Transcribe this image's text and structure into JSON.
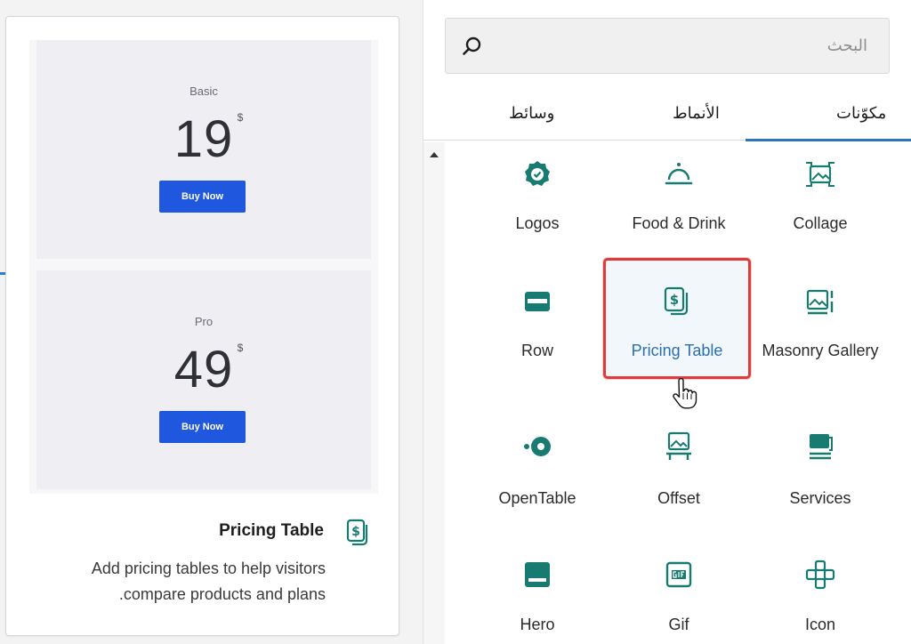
{
  "preview": {
    "plans": [
      {
        "name": "Basic",
        "price": "19",
        "currency": "$",
        "button": "Buy Now"
      },
      {
        "name": "Pro",
        "price": "49",
        "currency": "$",
        "button": "Buy Now"
      }
    ],
    "block_title": "Pricing Table",
    "block_description_line1": "Add pricing tables to help visitors",
    "block_description_line2": ".compare products and plans"
  },
  "search": {
    "placeholder": "البحث"
  },
  "tabs": [
    {
      "label": "مكوّنات",
      "active": true
    },
    {
      "label": "الأنماط",
      "active": false
    },
    {
      "label": "وسائط",
      "active": false
    }
  ],
  "blocks": [
    {
      "label": "Collage",
      "icon": "collage-icon"
    },
    {
      "label": "Food & Drink",
      "icon": "food-drink-icon"
    },
    {
      "label": "Logos",
      "icon": "logos-icon"
    },
    {
      "label": "Masonry Gallery",
      "icon": "masonry-gallery-icon"
    },
    {
      "label": "Pricing Table",
      "icon": "pricing-table-icon",
      "highlighted": true
    },
    {
      "label": "Row",
      "icon": "row-icon"
    },
    {
      "label": "Services",
      "icon": "services-icon"
    },
    {
      "label": "Offset",
      "icon": "offset-icon"
    },
    {
      "label": "OpenTable",
      "icon": "opentable-icon"
    },
    {
      "label": "Icon",
      "icon": "icon-block-icon"
    },
    {
      "label": "Gif",
      "icon": "gif-icon"
    },
    {
      "label": "Hero",
      "icon": "hero-icon"
    }
  ],
  "colors": {
    "accent": "#2a74b8",
    "icon": "#177b72",
    "highlight_border": "#de3b3b",
    "buy_button": "#1f57de"
  }
}
